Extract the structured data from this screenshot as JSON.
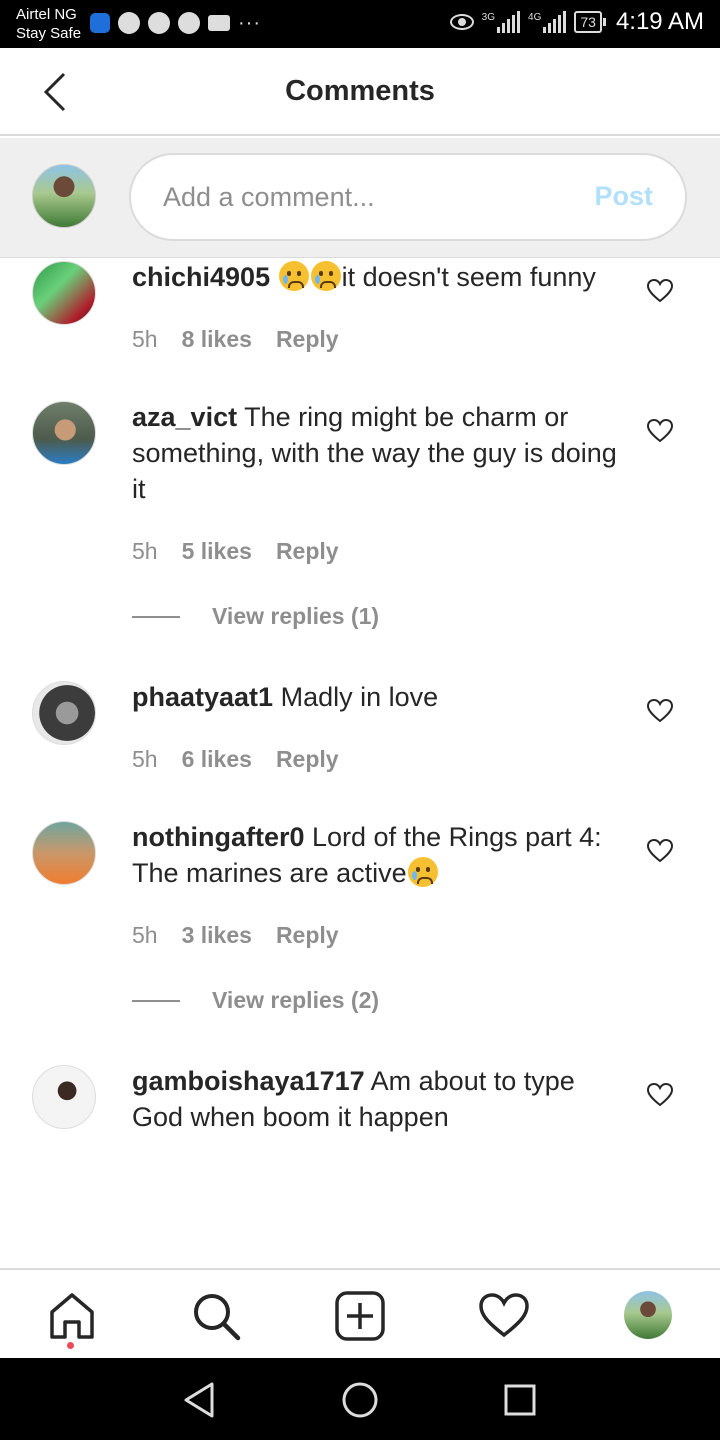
{
  "status_bar": {
    "carrier_line1": "Airtel NG",
    "carrier_line2": "Stay Safe",
    "network1": "3G",
    "network2": "4G",
    "battery": "73",
    "time": "4:19 AM",
    "dots": "···"
  },
  "header": {
    "title": "Comments"
  },
  "composer": {
    "placeholder": "Add a comment...",
    "value": "",
    "post_label": "Post",
    "post_color": "#b2dffc"
  },
  "comments": [
    {
      "username": "chichi4905",
      "text_before": "",
      "emojis_before": 2,
      "text": "it doesn't seem funny",
      "time": "5h",
      "likes": "8 likes",
      "reply": "Reply"
    },
    {
      "username": "aza_vict",
      "text": "The ring might be charm or something, with the way the guy is doing it",
      "time": "5h",
      "likes": "5 likes",
      "reply": "Reply",
      "view_replies": "View replies (1)"
    },
    {
      "username": "phaatyaat1",
      "text": "Madly in love",
      "time": "5h",
      "likes": "6 likes",
      "reply": "Reply"
    },
    {
      "username": "nothingafter0",
      "text": "Lord of the Rings part 4: The marines are active",
      "time": "5h",
      "likes": "3 likes",
      "reply": "Reply",
      "view_replies": "View replies (2)"
    },
    {
      "username": "gamboishaya1717",
      "text": "Am about to type God when boom it happen"
    }
  ],
  "icons": {
    "back": "chevron-left-icon",
    "like": "heart-icon",
    "home": "home-icon",
    "search": "search-icon",
    "new_post": "plus-square-icon",
    "activity": "heart-icon",
    "profile": "avatar"
  },
  "colors": {
    "notification_dot": "#ed4956",
    "secondary_text": "#8e8e8e",
    "primary_text": "#262626"
  }
}
